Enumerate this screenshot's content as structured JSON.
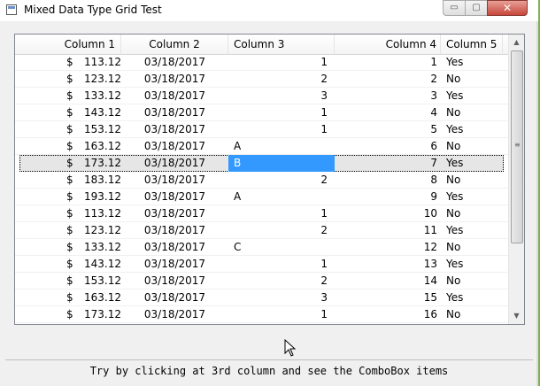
{
  "window": {
    "title": "Mixed Data Type Grid Test",
    "controls": {
      "minimize": "▭",
      "maximize": "▢",
      "close": "✕"
    }
  },
  "grid": {
    "columns": [
      "Column 1",
      "Column 2",
      "Column 3",
      "Column 4",
      "Column 5"
    ],
    "rows": [
      {
        "c1cur": "$",
        "c1": "113.12",
        "c2": "03/18/2017",
        "c3": "1",
        "c3align": "right",
        "c4": "1",
        "c5": "Yes"
      },
      {
        "c1cur": "$",
        "c1": "123.12",
        "c2": "03/18/2017",
        "c3": "2",
        "c3align": "right",
        "c4": "2",
        "c5": "No"
      },
      {
        "c1cur": "$",
        "c1": "133.12",
        "c2": "03/18/2017",
        "c3": "3",
        "c3align": "right",
        "c4": "3",
        "c5": "Yes"
      },
      {
        "c1cur": "$",
        "c1": "143.12",
        "c2": "03/18/2017",
        "c3": "1",
        "c3align": "right",
        "c4": "4",
        "c5": "No"
      },
      {
        "c1cur": "$",
        "c1": "153.12",
        "c2": "03/18/2017",
        "c3": "1",
        "c3align": "right",
        "c4": "5",
        "c5": "Yes"
      },
      {
        "c1cur": "$",
        "c1": "163.12",
        "c2": "03/18/2017",
        "c3": "A",
        "c3align": "left",
        "c4": "6",
        "c5": "No"
      },
      {
        "c1cur": "$",
        "c1": "173.12",
        "c2": "03/18/2017",
        "c3": "B",
        "c3align": "left",
        "c4": "7",
        "c5": "Yes",
        "selected": true
      },
      {
        "c1cur": "$",
        "c1": "183.12",
        "c2": "03/18/2017",
        "c3": "2",
        "c3align": "right",
        "c4": "8",
        "c5": "No"
      },
      {
        "c1cur": "$",
        "c1": "193.12",
        "c2": "03/18/2017",
        "c3": "A",
        "c3align": "left",
        "c4": "9",
        "c5": "Yes"
      },
      {
        "c1cur": "$",
        "c1": "113.12",
        "c2": "03/18/2017",
        "c3": "1",
        "c3align": "right",
        "c4": "10",
        "c5": "No"
      },
      {
        "c1cur": "$",
        "c1": "123.12",
        "c2": "03/18/2017",
        "c3": "2",
        "c3align": "right",
        "c4": "11",
        "c5": "Yes"
      },
      {
        "c1cur": "$",
        "c1": "133.12",
        "c2": "03/18/2017",
        "c3": "C",
        "c3align": "left",
        "c4": "12",
        "c5": "No"
      },
      {
        "c1cur": "$",
        "c1": "143.12",
        "c2": "03/18/2017",
        "c3": "1",
        "c3align": "right",
        "c4": "13",
        "c5": "Yes"
      },
      {
        "c1cur": "$",
        "c1": "153.12",
        "c2": "03/18/2017",
        "c3": "2",
        "c3align": "right",
        "c4": "14",
        "c5": "No"
      },
      {
        "c1cur": "$",
        "c1": "163.12",
        "c2": "03/18/2017",
        "c3": "3",
        "c3align": "right",
        "c4": "15",
        "c5": "Yes"
      },
      {
        "c1cur": "$",
        "c1": "173.12",
        "c2": "03/18/2017",
        "c3": "1",
        "c3align": "right",
        "c4": "16",
        "c5": "No"
      }
    ],
    "scrollbar": {
      "up_arrow": "▲",
      "down_arrow": "▼",
      "grip": "≡"
    },
    "colors": {
      "selection": "#3399ff",
      "selected_row": "#e6e6e6"
    }
  },
  "status": {
    "text": "Try by clicking at 3rd column and see the ComboBox items"
  }
}
